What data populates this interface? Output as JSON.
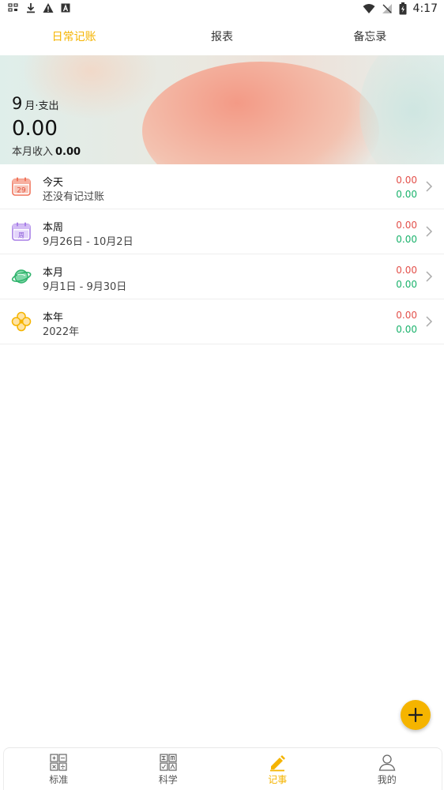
{
  "status_bar": {
    "time": "4:17"
  },
  "tabs": [
    {
      "label": "日常记账",
      "active": true
    },
    {
      "label": "报表",
      "active": false
    },
    {
      "label": "备忘录",
      "active": false
    }
  ],
  "banner": {
    "month": "9",
    "month_suffix": "月·支出",
    "expense": "0.00",
    "income_label": "本月收入",
    "income_value": "0.00"
  },
  "list": [
    {
      "icon": "calendar-day-icon",
      "icon_text": "29",
      "title": "今天",
      "subtitle": "还没有记过账",
      "expense": "0.00",
      "income": "0.00"
    },
    {
      "icon": "calendar-week-icon",
      "icon_text": "周",
      "title": "本周",
      "subtitle": "9月26日 - 10月2日",
      "expense": "0.00",
      "income": "0.00"
    },
    {
      "icon": "planet-icon",
      "title": "本月",
      "subtitle": "9月1日 - 9月30日",
      "expense": "0.00",
      "income": "0.00"
    },
    {
      "icon": "flower-icon",
      "title": "本年",
      "subtitle": "2022年",
      "expense": "0.00",
      "income": "0.00"
    }
  ],
  "bottom_nav": [
    {
      "label": "标准",
      "icon": "calculator-icon",
      "active": false
    },
    {
      "label": "科学",
      "icon": "scientific-calculator-icon",
      "active": false
    },
    {
      "label": "记事",
      "icon": "pencil-icon",
      "active": true
    },
    {
      "label": "我的",
      "icon": "person-icon",
      "active": false
    }
  ],
  "colors": {
    "accent": "#f5b400",
    "expense": "#e3504a",
    "income": "#19b26b"
  }
}
